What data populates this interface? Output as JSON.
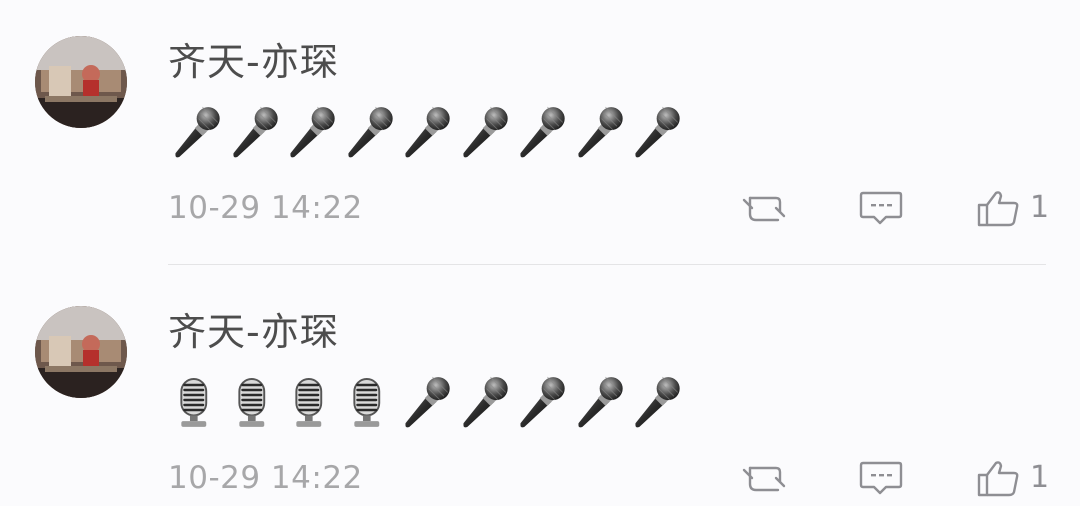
{
  "comments": [
    {
      "username": "齐天-亦琛",
      "emoji": [
        "microphone",
        "microphone",
        "microphone",
        "microphone",
        "microphone",
        "microphone",
        "microphone",
        "microphone",
        "microphone"
      ],
      "timestamp": "10-29 14:22",
      "likes": "1"
    },
    {
      "username": "齐天-亦琛",
      "emoji": [
        "studio-microphone",
        "studio-microphone",
        "studio-microphone",
        "studio-microphone",
        "microphone",
        "microphone",
        "microphone",
        "microphone",
        "microphone"
      ],
      "timestamp": "10-29 14:22",
      "likes": "1"
    }
  ],
  "icons": {
    "repost": "repost-icon",
    "reply": "reply-icon",
    "like": "thumbs-up-icon"
  },
  "colors": {
    "background": "#fbfbfd",
    "username": "#4d4d4d",
    "timestamp": "#a7a7a9",
    "icon": "#8e8e93"
  }
}
